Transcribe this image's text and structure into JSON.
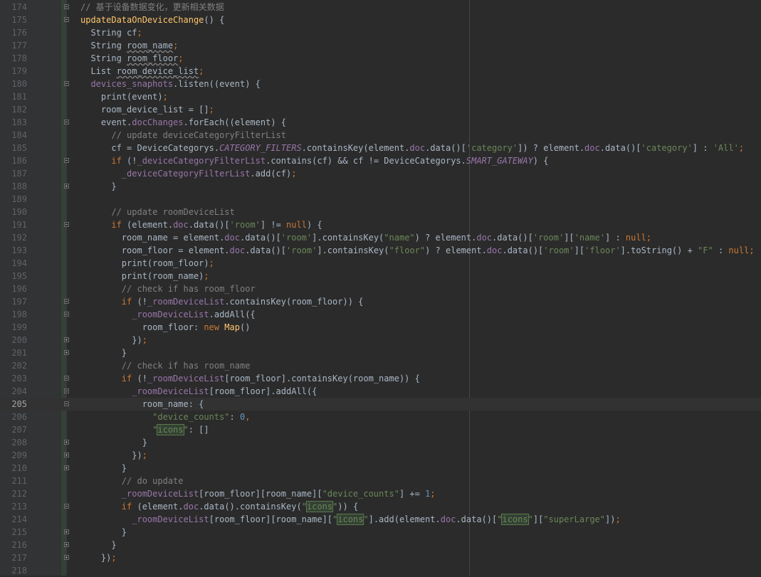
{
  "editor": {
    "lines": [
      {
        "num": "174",
        "fold": "open",
        "tokens": [
          [
            "comment",
            "// 基于设备数据变化，更新相关数据"
          ]
        ]
      },
      {
        "num": "175",
        "fold": "open",
        "tokens": [
          [
            "fn",
            "updateDataOnDeviceChange"
          ],
          [
            "plain",
            "() {"
          ]
        ]
      },
      {
        "num": "176",
        "fold": "",
        "tokens": [
          [
            "plain",
            "  String cf"
          ],
          [
            "kw",
            ";"
          ]
        ]
      },
      {
        "num": "177",
        "fold": "",
        "tokens": [
          [
            "plain",
            "  String "
          ],
          [
            "wavy",
            "room_name"
          ],
          [
            "kw",
            ";"
          ]
        ]
      },
      {
        "num": "178",
        "fold": "",
        "tokens": [
          [
            "plain",
            "  String "
          ],
          [
            "wavy",
            "room_floor"
          ],
          [
            "kw",
            ";"
          ]
        ]
      },
      {
        "num": "179",
        "fold": "",
        "tokens": [
          [
            "plain",
            "  List "
          ],
          [
            "wavy",
            "room_device_list"
          ],
          [
            "kw",
            ";"
          ]
        ]
      },
      {
        "num": "180",
        "fold": "open",
        "tokens": [
          [
            "field",
            "  devices_snaphots"
          ],
          [
            "plain",
            ".listen((event) {"
          ]
        ]
      },
      {
        "num": "181",
        "fold": "",
        "tokens": [
          [
            "plain",
            "    print(event)"
          ],
          [
            "kw",
            ";"
          ]
        ]
      },
      {
        "num": "182",
        "fold": "",
        "tokens": [
          [
            "plain",
            "    room_device_list = []"
          ],
          [
            "kw",
            ";"
          ]
        ]
      },
      {
        "num": "183",
        "fold": "open",
        "tokens": [
          [
            "plain",
            "    event."
          ],
          [
            "field",
            "docChanges"
          ],
          [
            "plain",
            ".forEach((element) {"
          ]
        ]
      },
      {
        "num": "184",
        "fold": "",
        "tokens": [
          [
            "comment",
            "      // update deviceCategoryFilterList"
          ]
        ]
      },
      {
        "num": "185",
        "fold": "",
        "tokens": [
          [
            "plain",
            "      cf = DeviceCategorys."
          ],
          [
            "italic",
            "CATEGORY_FILTERS"
          ],
          [
            "plain",
            ".containsKey(element."
          ],
          [
            "field",
            "doc"
          ],
          [
            "plain",
            ".data()["
          ],
          [
            "str",
            "'category'"
          ],
          [
            "plain",
            "]) ? element."
          ],
          [
            "field",
            "doc"
          ],
          [
            "plain",
            ".data()["
          ],
          [
            "str",
            "'category'"
          ],
          [
            "plain",
            "] : "
          ],
          [
            "str",
            "'All'"
          ],
          [
            "kw",
            ";"
          ]
        ]
      },
      {
        "num": "186",
        "fold": "open",
        "tokens": [
          [
            "kw",
            "      if "
          ],
          [
            "plain",
            "(!"
          ],
          [
            "field",
            "_deviceCategoryFilterList"
          ],
          [
            "plain",
            ".contains(cf) && cf != DeviceCategorys."
          ],
          [
            "italic",
            "SMART_GATEWAY"
          ],
          [
            "plain",
            ") {"
          ]
        ]
      },
      {
        "num": "187",
        "fold": "",
        "tokens": [
          [
            "field",
            "        _deviceCategoryFilterList"
          ],
          [
            "plain",
            ".add(cf)"
          ],
          [
            "kw",
            ";"
          ]
        ]
      },
      {
        "num": "188",
        "fold": "close",
        "tokens": [
          [
            "plain",
            "      }"
          ]
        ]
      },
      {
        "num": "189",
        "fold": "",
        "tokens": []
      },
      {
        "num": "190",
        "fold": "",
        "tokens": [
          [
            "comment",
            "      // update roomDeviceList"
          ]
        ]
      },
      {
        "num": "191",
        "fold": "open",
        "tokens": [
          [
            "kw",
            "      if "
          ],
          [
            "plain",
            "(element."
          ],
          [
            "field",
            "doc"
          ],
          [
            "plain",
            ".data()["
          ],
          [
            "str",
            "'room'"
          ],
          [
            "plain",
            "] != "
          ],
          [
            "kw",
            "null"
          ],
          [
            "plain",
            ") {"
          ]
        ]
      },
      {
        "num": "192",
        "fold": "",
        "tokens": [
          [
            "plain",
            "        room_name = element."
          ],
          [
            "field",
            "doc"
          ],
          [
            "plain",
            ".data()["
          ],
          [
            "str",
            "'room'"
          ],
          [
            "plain",
            "].containsKey("
          ],
          [
            "str",
            "\"name\""
          ],
          [
            "plain",
            ") ? element."
          ],
          [
            "field",
            "doc"
          ],
          [
            "plain",
            ".data()["
          ],
          [
            "str",
            "'room'"
          ],
          [
            "plain",
            "]["
          ],
          [
            "str",
            "'name'"
          ],
          [
            "plain",
            "] : "
          ],
          [
            "kw",
            "null;"
          ]
        ]
      },
      {
        "num": "193",
        "fold": "",
        "tokens": [
          [
            "plain",
            "        room_floor = element."
          ],
          [
            "field",
            "doc"
          ],
          [
            "plain",
            ".data()["
          ],
          [
            "str",
            "'room'"
          ],
          [
            "plain",
            "].containsKey("
          ],
          [
            "str",
            "\"floor\""
          ],
          [
            "plain",
            ") ? element."
          ],
          [
            "field",
            "doc"
          ],
          [
            "plain",
            ".data()["
          ],
          [
            "str",
            "'room'"
          ],
          [
            "plain",
            "]["
          ],
          [
            "str",
            "'floor'"
          ],
          [
            "plain",
            "].toString() + "
          ],
          [
            "str",
            "\"F\""
          ],
          [
            "plain",
            " : "
          ],
          [
            "kw",
            "null;"
          ]
        ]
      },
      {
        "num": "194",
        "fold": "",
        "tokens": [
          [
            "plain",
            "        print(room_floor)"
          ],
          [
            "kw",
            ";"
          ]
        ]
      },
      {
        "num": "195",
        "fold": "",
        "tokens": [
          [
            "plain",
            "        print(room_name)"
          ],
          [
            "kw",
            ";"
          ]
        ]
      },
      {
        "num": "196",
        "fold": "",
        "tokens": [
          [
            "comment",
            "        // check if has room_floor"
          ]
        ]
      },
      {
        "num": "197",
        "fold": "open",
        "tokens": [
          [
            "kw",
            "        if "
          ],
          [
            "plain",
            "(!"
          ],
          [
            "field",
            "_roomDeviceList"
          ],
          [
            "plain",
            ".containsKey(room_floor)) {"
          ]
        ]
      },
      {
        "num": "198",
        "fold": "open",
        "tokens": [
          [
            "field",
            "          _roomDeviceList"
          ],
          [
            "plain",
            ".addAll({"
          ]
        ]
      },
      {
        "num": "199",
        "fold": "",
        "tokens": [
          [
            "plain",
            "            room_floor: "
          ],
          [
            "kw",
            "new "
          ],
          [
            "fn",
            "Map"
          ],
          [
            "plain",
            "()"
          ]
        ]
      },
      {
        "num": "200",
        "fold": "close",
        "tokens": [
          [
            "plain",
            "          })"
          ],
          [
            "kw",
            ";"
          ]
        ]
      },
      {
        "num": "201",
        "fold": "close",
        "tokens": [
          [
            "plain",
            "        }"
          ]
        ]
      },
      {
        "num": "202",
        "fold": "",
        "tokens": [
          [
            "comment",
            "        // check if has room_name"
          ]
        ]
      },
      {
        "num": "203",
        "fold": "open",
        "tokens": [
          [
            "kw",
            "        if "
          ],
          [
            "plain",
            "(!"
          ],
          [
            "field",
            "_roomDeviceList"
          ],
          [
            "plain",
            "[room_floor].containsKey(room_name)) {"
          ]
        ]
      },
      {
        "num": "204",
        "fold": "open",
        "tokens": [
          [
            "field",
            "          _roomDeviceList"
          ],
          [
            "plain",
            "[room_floor].addAll({"
          ]
        ]
      },
      {
        "num": "205",
        "fold": "open",
        "tokens": [
          [
            "plain",
            "            room_name: {"
          ]
        ]
      },
      {
        "num": "206",
        "fold": "",
        "tokens": [
          [
            "str",
            "              \"device_counts\""
          ],
          [
            "plain",
            ": "
          ],
          [
            "num",
            "0"
          ],
          [
            "kw",
            ","
          ]
        ]
      },
      {
        "num": "207",
        "fold": "",
        "tokens": [
          [
            "str",
            "              \""
          ],
          [
            "hl",
            "icons"
          ],
          [
            "str",
            "\""
          ],
          [
            "plain",
            ": []"
          ]
        ]
      },
      {
        "num": "208",
        "fold": "close",
        "tokens": [
          [
            "plain",
            "            }"
          ]
        ]
      },
      {
        "num": "209",
        "fold": "close",
        "tokens": [
          [
            "plain",
            "          })"
          ],
          [
            "kw",
            ";"
          ]
        ]
      },
      {
        "num": "210",
        "fold": "close",
        "tokens": [
          [
            "plain",
            "        }"
          ]
        ]
      },
      {
        "num": "211",
        "fold": "",
        "tokens": [
          [
            "comment",
            "        // do update"
          ]
        ]
      },
      {
        "num": "212",
        "fold": "",
        "tokens": [
          [
            "field",
            "        _roomDeviceList"
          ],
          [
            "plain",
            "[room_floor][room_name]["
          ],
          [
            "str",
            "\"device_counts\""
          ],
          [
            "plain",
            "] += "
          ],
          [
            "num",
            "1"
          ],
          [
            "kw",
            ";"
          ]
        ]
      },
      {
        "num": "213",
        "fold": "open",
        "tokens": [
          [
            "kw",
            "        if "
          ],
          [
            "plain",
            "(element."
          ],
          [
            "field",
            "doc"
          ],
          [
            "plain",
            ".data().containsKey("
          ],
          [
            "str",
            "\""
          ],
          [
            "hl",
            "icons"
          ],
          [
            "str",
            "\""
          ],
          [
            "plain",
            ")) {"
          ]
        ]
      },
      {
        "num": "214",
        "fold": "",
        "tokens": [
          [
            "field",
            "          _roomDeviceList"
          ],
          [
            "plain",
            "[room_floor][room_name]["
          ],
          [
            "str",
            "\""
          ],
          [
            "hl",
            "icons"
          ],
          [
            "str",
            "\""
          ],
          [
            "plain",
            "].add(element."
          ],
          [
            "field",
            "doc"
          ],
          [
            "plain",
            ".data()["
          ],
          [
            "str",
            "\""
          ],
          [
            "hl",
            "icons"
          ],
          [
            "str",
            "\""
          ],
          [
            "plain",
            "]["
          ],
          [
            "str",
            "\"superLarge\""
          ],
          [
            "plain",
            "])"
          ],
          [
            "kw",
            ";"
          ]
        ]
      },
      {
        "num": "215",
        "fold": "close",
        "tokens": [
          [
            "plain",
            "        }"
          ]
        ]
      },
      {
        "num": "216",
        "fold": "close",
        "tokens": [
          [
            "plain",
            "      }"
          ]
        ]
      },
      {
        "num": "217",
        "fold": "close",
        "tokens": [
          [
            "plain",
            "    })"
          ],
          [
            "kw",
            ";"
          ]
        ]
      },
      {
        "num": "218",
        "fold": "",
        "tokens": []
      }
    ],
    "current_line": "205"
  },
  "colors": {
    "background": "#2b2b2b",
    "gutter": "#313335",
    "keyword": "#cc7832",
    "string": "#6a8759",
    "number": "#6897bb",
    "comment": "#808080",
    "field": "#9876aa",
    "function": "#ffc66d",
    "text": "#a9b7c6"
  }
}
